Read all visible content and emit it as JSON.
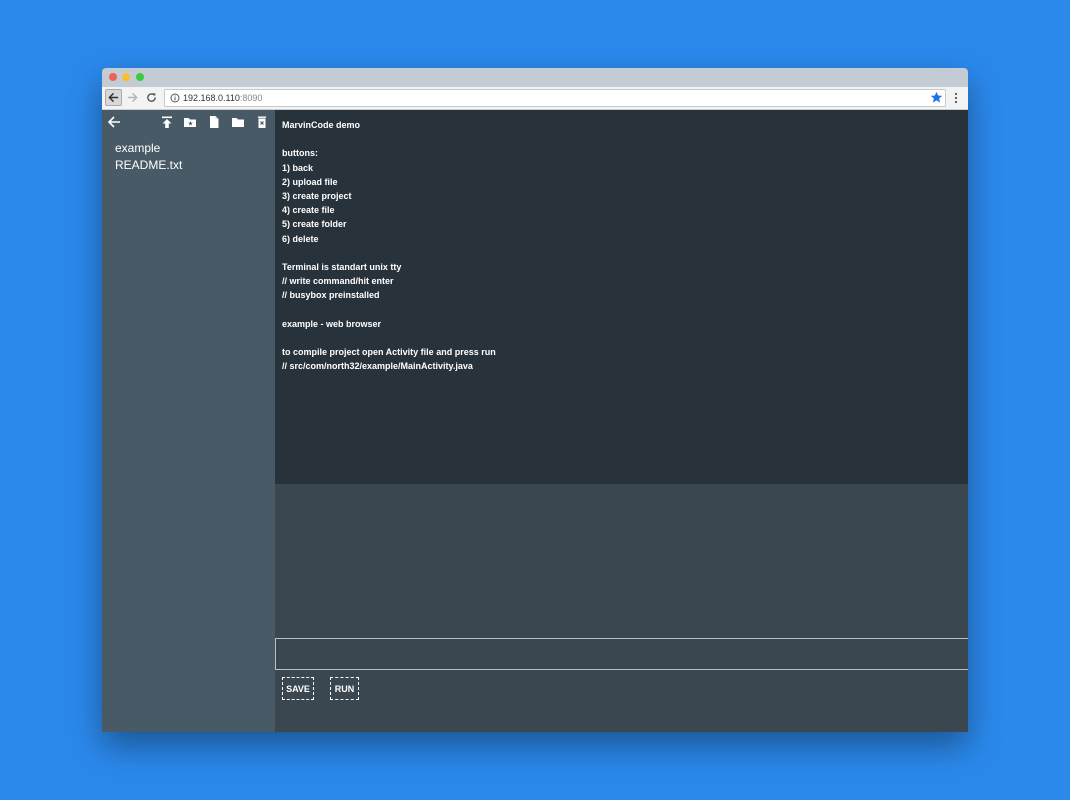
{
  "browser": {
    "url_host": "192.168.0.110",
    "url_port": ":8090",
    "icons": [
      "back-arrow-icon",
      "forward-arrow-icon",
      "reload-icon",
      "info-icon",
      "star-icon",
      "menu-dots-icon"
    ]
  },
  "sidebar": {
    "toolbar_icons": [
      "back-arrow-icon",
      "upload-icon",
      "create-project-icon",
      "create-file-icon",
      "create-folder-icon",
      "delete-icon"
    ],
    "files": [
      {
        "label": "example"
      },
      {
        "label": "README.txt"
      }
    ]
  },
  "editor": {
    "lines": [
      "MarvinCode demo",
      "",
      "buttons:",
      "1) back",
      "2) upload file",
      "3) create project",
      "4) create file",
      "5) create folder",
      "6) delete",
      "",
      "Terminal is standart unix tty",
      "// write command/hit enter",
      "// busybox preinstalled",
      "",
      "example - web browser",
      "",
      "to compile project open Activity file and press run",
      "// src/com/north32/example/MainActivity.java"
    ]
  },
  "terminal": {
    "input_value": ""
  },
  "actions": {
    "save_label": "SAVE",
    "run_label": "RUN"
  },
  "colors": {
    "page_background": "#2b89ec",
    "sidebar": "#475a66",
    "editor": "#28323a",
    "terminal": "#3a4750",
    "star_accent": "#1a73e8"
  }
}
